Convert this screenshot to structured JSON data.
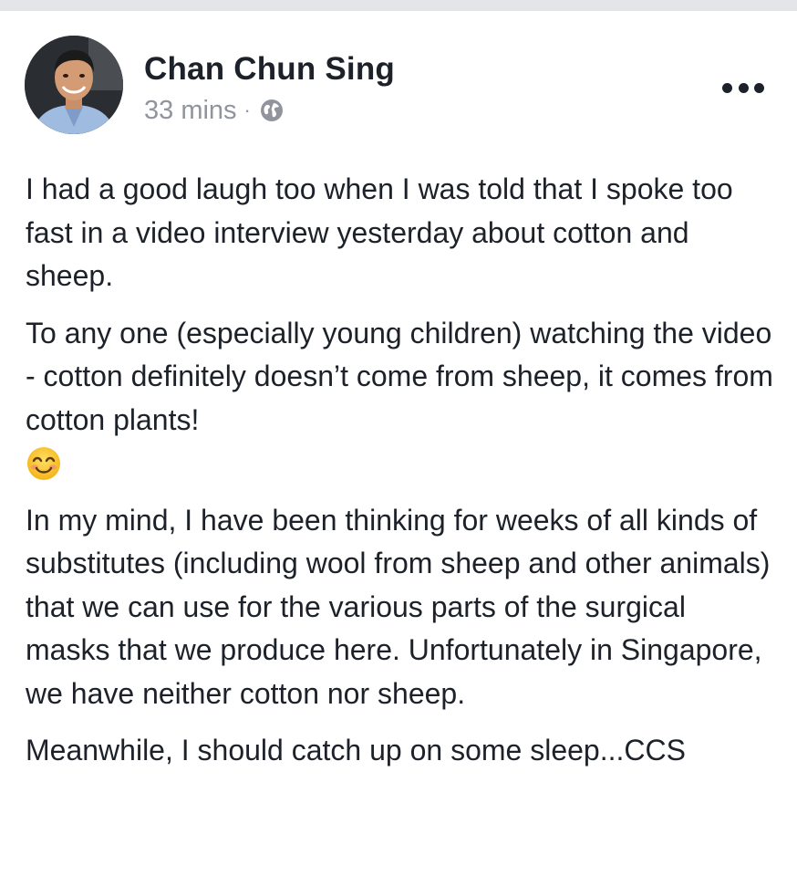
{
  "post": {
    "author": "Chan Chun Sing",
    "timestamp": "33 mins",
    "separator": "·",
    "privacy_icon": "globe-icon",
    "more_icon": "more-horizontal-icon",
    "paragraphs": [
      "I had a good laugh too when I was told that I spoke too fast in a video interview yesterday about cotton and sheep.",
      "To any one (especially young children) watching the video - cotton definitely doesn’t come from sheep, it comes from cotton plants!",
      "In my mind, I have been thinking for weeks of all kinds of substitutes (including wool from sheep and other animals) that we can use for the various parts of the surgical masks that we produce here. Unfortunately in Singapore, we have neither cotton nor sheep.",
      "Meanwhile, I should catch up on some sleep...CCS"
    ],
    "emoji": "smiling-face-icon"
  },
  "colors": {
    "name_text": "#1d2129",
    "meta_text": "#90949c",
    "top_strip": "#e4e5e9"
  }
}
